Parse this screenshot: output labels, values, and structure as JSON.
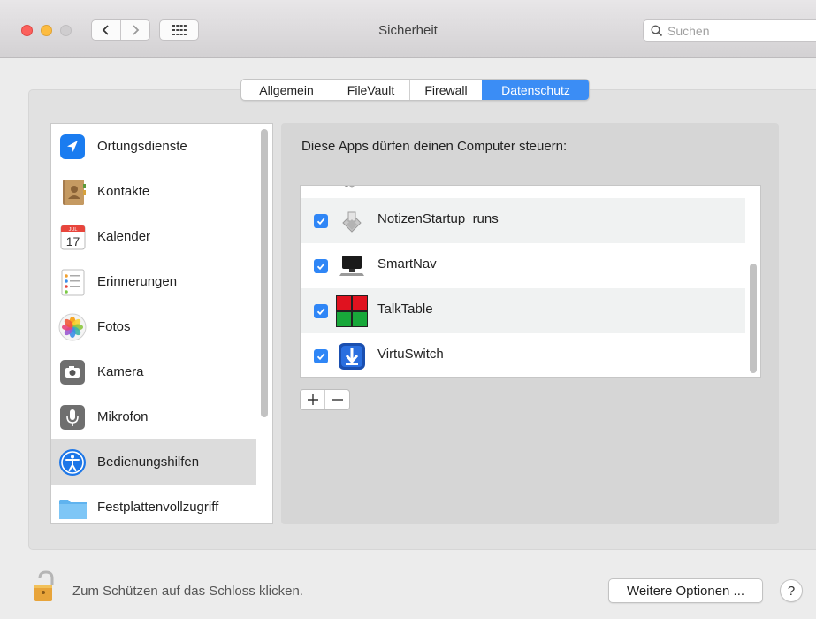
{
  "window": {
    "title": "Sicherheit"
  },
  "search": {
    "placeholder": "Suchen"
  },
  "tabs": [
    {
      "label": "Allgemein",
      "selected": false
    },
    {
      "label": "FileVault",
      "selected": false
    },
    {
      "label": "Firewall",
      "selected": false
    },
    {
      "label": "Datenschutz",
      "selected": true
    }
  ],
  "sidebar": {
    "items": [
      {
        "label": "Ortungsdienste",
        "icon": "location-arrow-icon"
      },
      {
        "label": "Kontakte",
        "icon": "contacts-book-icon"
      },
      {
        "label": "Kalender",
        "icon": "calendar-icon",
        "icon_month": "JUL",
        "icon_day": "17"
      },
      {
        "label": "Erinnerungen",
        "icon": "reminders-icon"
      },
      {
        "label": "Fotos",
        "icon": "photos-flower-icon"
      },
      {
        "label": "Kamera",
        "icon": "camera-icon"
      },
      {
        "label": "Mikrofon",
        "icon": "microphone-icon"
      },
      {
        "label": "Bedienungshilfen",
        "icon": "accessibility-icon",
        "selected": true
      },
      {
        "label": "Festplattenvollzugriff",
        "icon": "folder-icon"
      }
    ]
  },
  "main": {
    "heading": "Diese Apps dürfen deinen Computer steuern:",
    "apps": [
      {
        "name": "NotizenStartup_runs",
        "checked": true,
        "icon": "generic-app-icon"
      },
      {
        "name": "SmartNav",
        "checked": true,
        "icon": "monitor-icon"
      },
      {
        "name": "TalkTable",
        "checked": true,
        "icon": "talktable-grid-icon"
      },
      {
        "name": "VirtuSwitch",
        "checked": true,
        "icon": "virtuswitch-arrow-icon"
      }
    ],
    "add_label": "+",
    "remove_label": "−"
  },
  "footer": {
    "lock_text": "Zum Schützen auf das Schloss klicken.",
    "more_options_label": "Weitere Optionen ...",
    "help_label": "?"
  },
  "colors": {
    "accent": "#3b8df5",
    "checkbox": "#2f86f6",
    "selected_row": "#dcdcdc"
  }
}
